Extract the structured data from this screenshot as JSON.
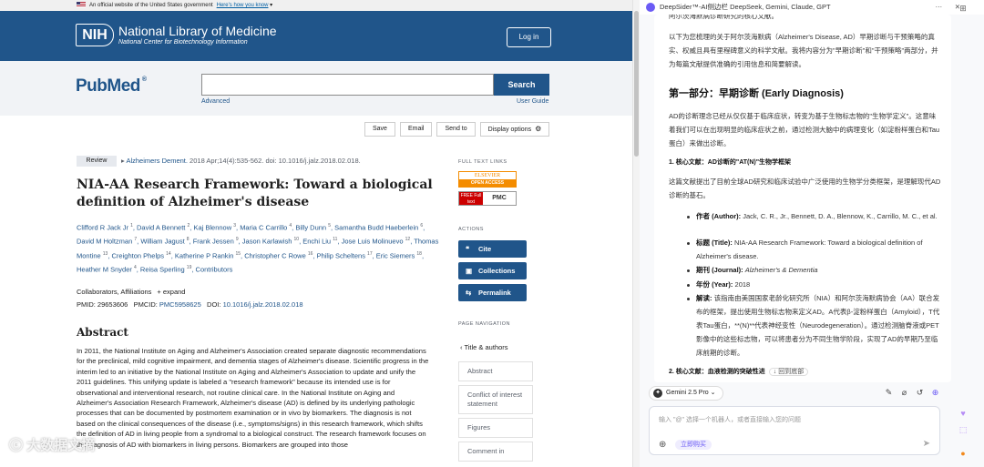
{
  "left": {
    "gov_banner": "An official website of the United States government",
    "gov_link": "Here's how you know",
    "nih_logo": "NIH",
    "nlm_name": "National Library of Medicine",
    "nlm_sub": "National Center for Biotechnology Information",
    "login": "Log in",
    "pubmed_logo": "PubMed",
    "pubmed_reg": "®",
    "search_value": "",
    "search_button": "Search",
    "advanced": "Advanced",
    "user_guide": "User Guide",
    "toolbar": [
      "Save",
      "Email",
      "Send to",
      "Display options"
    ],
    "review_badge": "Review",
    "citation_journal": "Alzheimers Dement.",
    "citation_rest": " 2018 Apr;14(4):535-562. doi: 10.1016/j.jalz.2018.02.018.",
    "title": "NIA-AA Research Framework: Toward a biological definition of Alzheimer's disease",
    "authors": [
      {
        "name": "Clifford R Jack Jr",
        "sup": "1"
      },
      {
        "name": "David A Bennett",
        "sup": "2"
      },
      {
        "name": "Kaj Blennow",
        "sup": "3"
      },
      {
        "name": "Maria C Carrillo",
        "sup": "4"
      },
      {
        "name": "Billy Dunn",
        "sup": "5"
      },
      {
        "name": "Samantha Budd Haeberlein",
        "sup": "6"
      },
      {
        "name": "David M Holtzman",
        "sup": "7"
      },
      {
        "name": "William Jagust",
        "sup": "8"
      },
      {
        "name": "Frank Jessen",
        "sup": "9"
      },
      {
        "name": "Jason Karlawish",
        "sup": "10"
      },
      {
        "name": "Enchi Liu",
        "sup": "11"
      },
      {
        "name": "Jose Luis Molinuevo",
        "sup": "12"
      },
      {
        "name": "Thomas Montine",
        "sup": "13"
      },
      {
        "name": "Creighton Phelps",
        "sup": "14"
      },
      {
        "name": "Katherine P Rankin",
        "sup": "15"
      },
      {
        "name": "Christopher C Rowe",
        "sup": "16"
      },
      {
        "name": "Philip Scheltens",
        "sup": "17"
      },
      {
        "name": "Eric Siemers",
        "sup": "18"
      },
      {
        "name": "Heather M Snyder",
        "sup": "4"
      },
      {
        "name": "Reisa Sperling",
        "sup": "19"
      },
      {
        "name": "Contributors",
        "sup": ""
      }
    ],
    "collaborators": "Collaborators, Affiliations",
    "expand": "+ expand",
    "pmid_label": "PMID: ",
    "pmid": "29653606",
    "pmcid_label": "PMCID: ",
    "pmcid": "PMC5958625",
    "doi_label": "DOI: ",
    "doi": "10.1016/j.jalz.2018.02.018",
    "abstract_heading": "Abstract",
    "abstract": "In 2011, the National Institute on Aging and Alzheimer's Association created separate diagnostic recommendations for the preclinical, mild cognitive impairment, and dementia stages of Alzheimer's disease. Scientific progress in the interim led to an initiative by the National Institute on Aging and Alzheimer's Association to update and unify the 2011 guidelines. This unifying update is labeled a \"research framework\" because its intended use is for observational and interventional research, not routine clinical care. In the National Institute on Aging and Alzheimer's Association Research Framework, Alzheimer's disease (AD) is defined by its underlying pathologic processes that can be documented by postmortem examination or in vivo by biomarkers. The diagnosis is not based on the clinical consequences of the disease (i.e., symptoms/signs) in this research framework, which shifts the definition of AD in living people from a syndromal to a biological construct. The research framework focuses on the diagnosis of AD with biomarkers in living persons. Biomarkers are grouped into those",
    "full_text_links_head": "FULL TEXT LINKS",
    "elsevier_top": "ELSEVIER",
    "elsevier_bot": "OPEN ACCESS",
    "pmc_free": "FREE Full text",
    "pmc_label": "PMC",
    "actions_head": "ACTIONS",
    "actions": [
      {
        "icon": "❝",
        "label": "Cite"
      },
      {
        "icon": "▣",
        "label": "Collections"
      },
      {
        "icon": "⇆",
        "label": "Permalink"
      }
    ],
    "page_nav_head": "PAGE NAVIGATION",
    "page_nav": [
      "Title & authors",
      "Abstract",
      "Conflict of interest statement",
      "Figures",
      "Comment in"
    ]
  },
  "right": {
    "window_title": "DeepSider™-AI侧边栏 DeepSeek, Gemini, Claude, GPT",
    "intro_tail": "阿尔茨海默病诊断研究的核心文献。",
    "intro": "以下为您梳理的关于阿尔茨海默病（Alzheimer's Disease, AD）早期诊断与干预策略的真实、权威且具有里程碑意义的科学文献。我将内容分为\"早期诊断\"和\"干预策略\"两部分，并为每篇文献提供准确的引用信息和简要解读。",
    "section1": "第一部分：早期诊断 (Early Diagnosis)",
    "section1_body": "AD的诊断理念已经从仅仅基于临床症状，转变为基于生物标志物的\"生物学定义\"。这意味着我们可以在出现明显的临床症状之前，通过检测大脑中的病理变化（如淀粉样蛋白和Tau蛋白）来做出诊断。",
    "core1": "1. 核心文献：AD诊断的\"AT(N)\"生物学框架",
    "core1_body": "这篇文献提出了目前全球AD研究和临床试验中广泛使用的生物学分类框架，是理解现代AD诊断的基石。",
    "items": [
      {
        "label": "作者 (Author):",
        "text": " Jack, C. R., Jr., Bennett, D. A., Blennow, K., Carrillo, M. C., et al."
      },
      {
        "label": "标题 (Title):",
        "text": " NIA-AA Research Framework: Toward a biological definition of Alzheimer's disease."
      },
      {
        "label": "期刊 (Journal):",
        "text": " Alzheimer's & Dementia"
      },
      {
        "label": "年份 (Year):",
        "text": " 2018"
      },
      {
        "label": "解读:",
        "text": " 该指南由美国国家老龄化研究所（NIA）和阿尔茨海默病协会（AA）联合发布的框架，提出使用生物标志物来定义AD。A代表β-淀粉样蛋白（Amyloid），T代表Tau蛋白，**(N)**代表神经变性（Neurodegeneration）。通过检测脑脊液或PET影像中的这些标志物，可以将患者分为不同生物学阶段，实现了AD的早期乃至临床前期的诊断。"
      }
    ],
    "core2": "2. 核心文献：血液检测的突破性进",
    "back_bottom": "回到底部",
    "model": "Gemini 2.5 Pro",
    "input_placeholder": "输入 \"@\" 选择一个机器人，或者直接输入您的问题",
    "optimize": "立即购买",
    "watermark": "大数据文摘"
  }
}
